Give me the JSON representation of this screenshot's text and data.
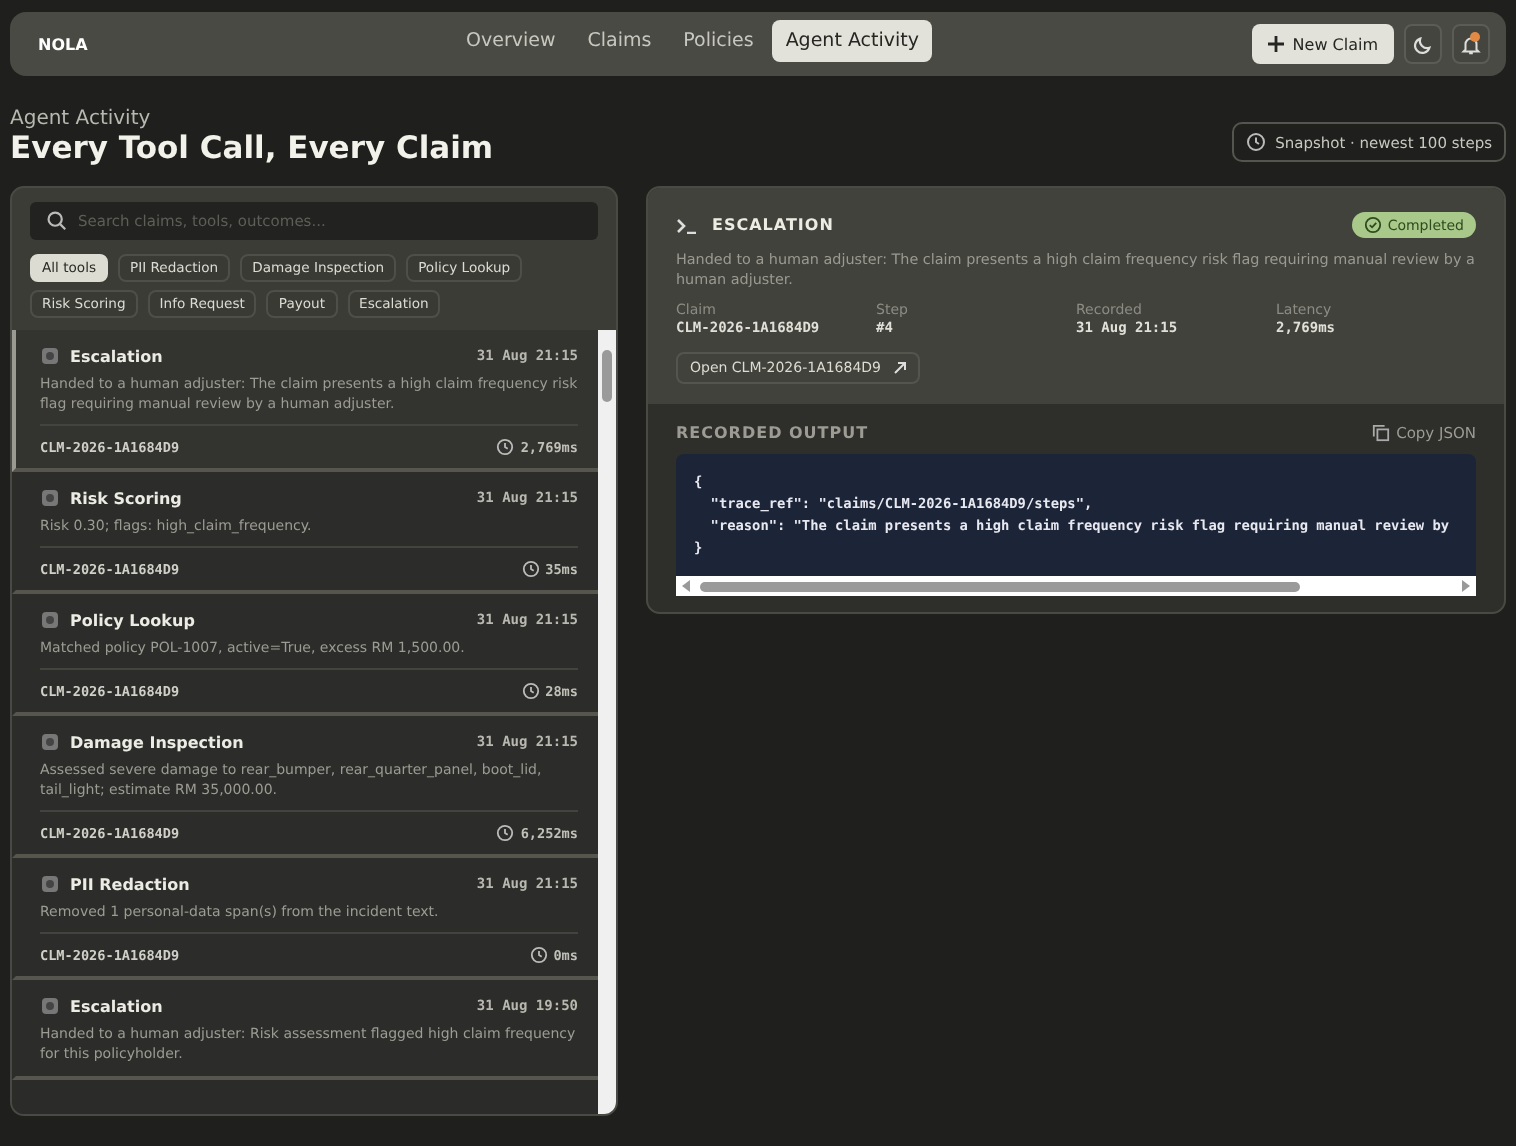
{
  "nav": {
    "brand": "NOLA",
    "tabs": [
      {
        "label": "Overview",
        "selected": false
      },
      {
        "label": "Claims",
        "selected": false
      },
      {
        "label": "Policies",
        "selected": false
      },
      {
        "label": "Agent Activity",
        "selected": true
      }
    ],
    "new_button": "New Claim",
    "notification_dot": true
  },
  "header": {
    "eyebrow": "Agent Activity",
    "title": "Every Tool Call, Every Claim",
    "snapshot": "Snapshot · newest 100 steps"
  },
  "filters": {
    "search": {
      "placeholder": "Search claims, tools, outcomes..."
    },
    "chips": [
      {
        "label": "All tools",
        "selected": true
      },
      {
        "label": "PII Redaction",
        "selected": false
      },
      {
        "label": "Damage Inspection",
        "selected": false
      },
      {
        "label": "Policy Lookup",
        "selected": false
      },
      {
        "label": "Risk Scoring",
        "selected": false
      },
      {
        "label": "Info Request",
        "selected": false
      },
      {
        "label": "Payout",
        "selected": false
      },
      {
        "label": "Escalation",
        "selected": false
      }
    ]
  },
  "steps": [
    {
      "tool": "Escalation",
      "time": "31 Aug 21:15",
      "summary": "Handed to a human adjuster: The claim presents a high claim frequency risk flag requiring manual review by a human adjuster.",
      "claim": "CLM-2026-1A1684D9",
      "latency": "2,769ms",
      "selected": true
    },
    {
      "tool": "Risk Scoring",
      "time": "31 Aug 21:15",
      "summary": "Risk 0.30; flags: high_claim_frequency.",
      "claim": "CLM-2026-1A1684D9",
      "latency": "35ms",
      "selected": false
    },
    {
      "tool": "Policy Lookup",
      "time": "31 Aug 21:15",
      "summary": "Matched policy POL-1007, active=True, excess RM 1,500.00.",
      "claim": "CLM-2026-1A1684D9",
      "latency": "28ms",
      "selected": false
    },
    {
      "tool": "Damage Inspection",
      "time": "31 Aug 21:15",
      "summary": "Assessed severe damage to rear_bumper, rear_quarter_panel, boot_lid, tail_light; estimate RM 35,000.00.",
      "claim": "CLM-2026-1A1684D9",
      "latency": "6,252ms",
      "selected": false
    },
    {
      "tool": "PII Redaction",
      "time": "31 Aug 21:15",
      "summary": "Removed 1 personal-data span(s) from the incident text.",
      "claim": "CLM-2026-1A1684D9",
      "latency": "0ms",
      "selected": false
    },
    {
      "tool": "Escalation",
      "time": "31 Aug 19:50",
      "summary": "Handed to a human adjuster: Risk assessment flagged high claim frequency for this policyholder.",
      "selected": false
    }
  ],
  "detail": {
    "tool": "ESCALATION",
    "status": "Completed",
    "summary": "Handed to a human adjuster: The claim presents a high claim frequency risk flag requiring manual review by a human adjuster.",
    "fields": [
      {
        "label": "Claim",
        "value": "CLM-2026-1A1684D9"
      },
      {
        "label": "Step",
        "value": "#4"
      },
      {
        "label": "Recorded",
        "value": "31 Aug 21:15"
      },
      {
        "label": "Latency",
        "value": "2,769ms"
      }
    ],
    "open_button": "Open CLM-2026-1A1684D9",
    "output_title": "RECORDED OUTPUT",
    "copy_button": "Copy JSON",
    "code_lines": [
      "{",
      "  \"trace_ref\": \"claims/CLM-2026-1A1684D9/steps\",",
      "  \"reason\": \"The claim presents a high claim frequency risk flag requiring manual review by",
      "}"
    ]
  }
}
